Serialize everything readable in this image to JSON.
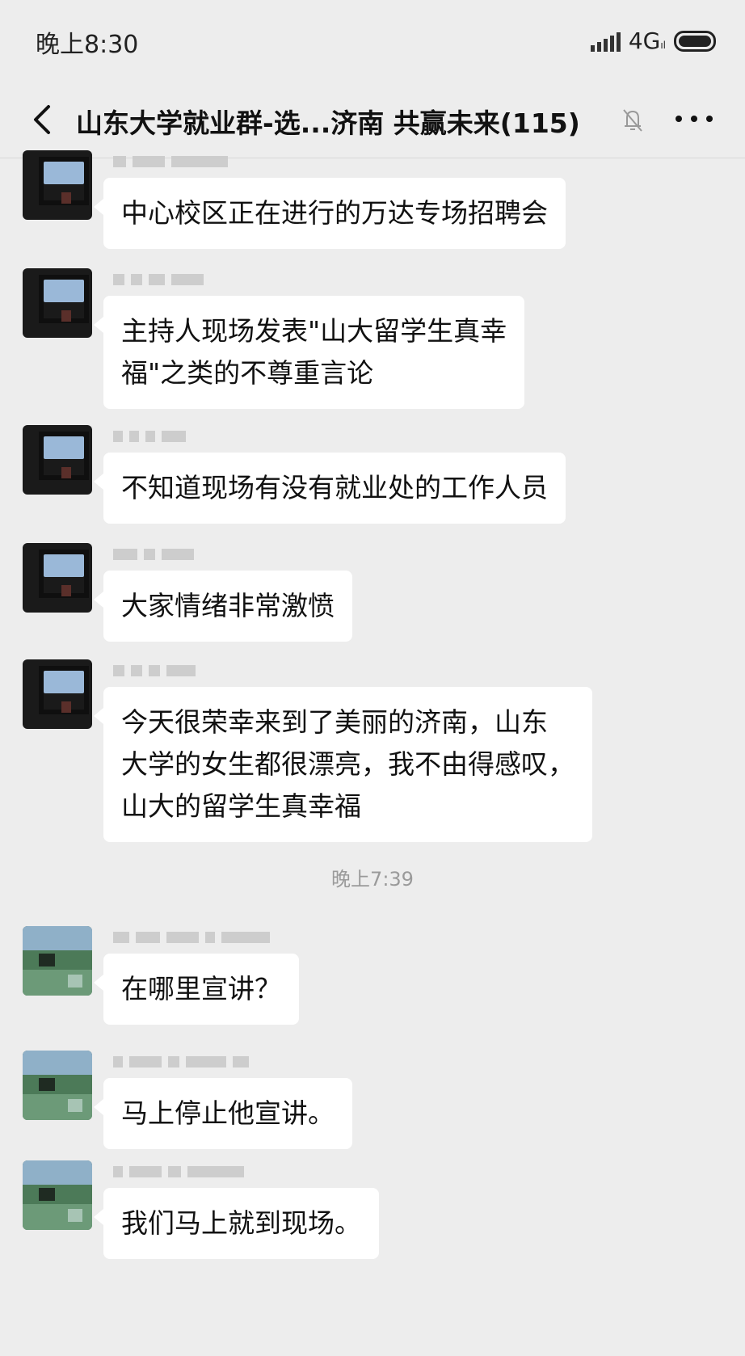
{
  "status_bar": {
    "time": "晚上8:30",
    "network": "4G",
    "network_sub": "ıl"
  },
  "nav": {
    "title": "山东大学就业群-选...济南 共赢未来(115)"
  },
  "chat": {
    "timestamp": "晚上7:39",
    "messages": [
      {
        "avatar": "dark",
        "text": [
          "中心校区正在进行的万达专场招聘会"
        ]
      },
      {
        "avatar": "dark",
        "text": [
          "主持人现场发表\"山大留学生真幸",
          "福\"之类的不尊重言论"
        ]
      },
      {
        "avatar": "dark",
        "text": [
          "不知道现场有没有就业处的工作人员"
        ]
      },
      {
        "avatar": "dark",
        "text": [
          "大家情绪非常激愤"
        ]
      },
      {
        "avatar": "dark",
        "text": [
          "今天很荣幸来到了美丽的济南，山东",
          "大学的女生都很漂亮，我不由得感叹，",
          "山大的留学生真幸福"
        ]
      },
      {
        "avatar": "green",
        "text": [
          "在哪里宣讲？"
        ]
      },
      {
        "avatar": "green",
        "text": [
          "马上停止他宣讲。"
        ]
      },
      {
        "avatar": "green",
        "text": [
          "我们马上就到现场。"
        ]
      }
    ]
  },
  "colors": {
    "background": "#ededed",
    "bubble": "#ffffff",
    "text": "#111111",
    "timestamp": "#9a9a9a"
  },
  "icons": [
    "back-arrow-icon",
    "mute-bell-icon",
    "more-icon",
    "signal-icon",
    "battery-icon"
  ]
}
